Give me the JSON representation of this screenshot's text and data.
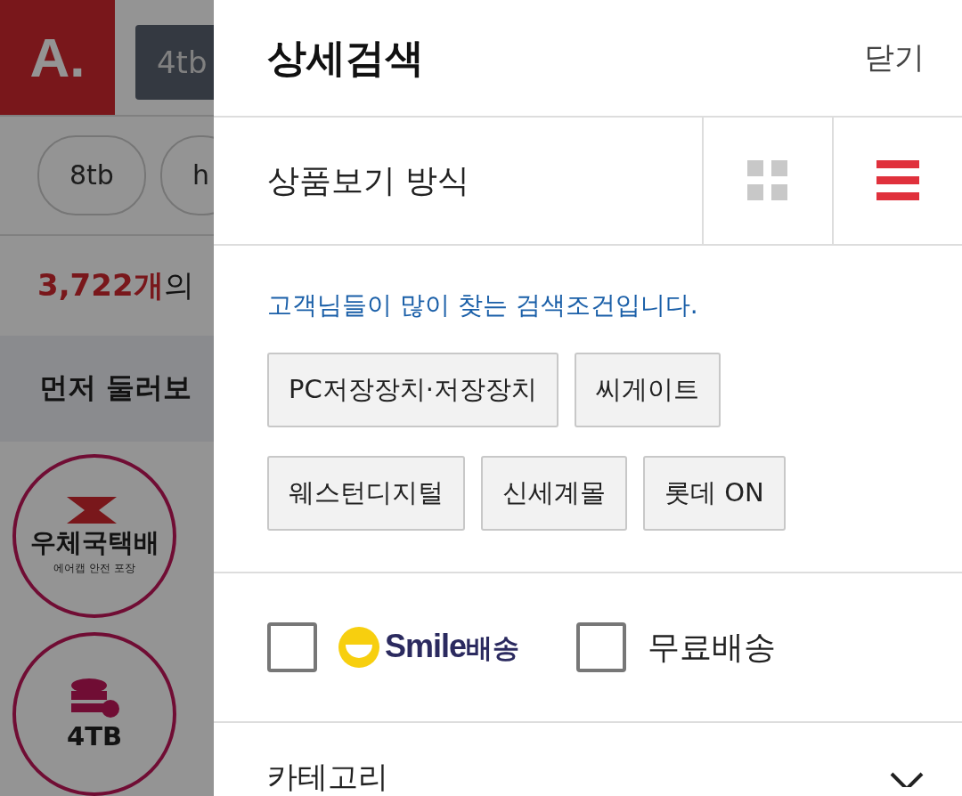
{
  "background_page": {
    "logo": "A.",
    "search_query": "4tb",
    "suggestion_chips": [
      {
        "label": "8tb"
      },
      {
        "label": "h"
      }
    ],
    "result_count": "3,722개",
    "result_suffix": "의",
    "section_title": "먼저 둘러보",
    "promo_badges": [
      {
        "title": "우체국택배",
        "subtitle": "에어캡 안전 포장"
      },
      {
        "title": "4TB"
      }
    ]
  },
  "panel": {
    "title": "상세검색",
    "close": "닫기",
    "view_mode": {
      "label": "상품보기 방식",
      "options": [
        {
          "kind": "grid",
          "selected": false
        },
        {
          "kind": "list",
          "selected": true
        }
      ]
    },
    "hint": "고객님들이 많이 찾는 검색조건입니다.",
    "chips": [
      {
        "label": "PC저장장치·저장장치"
      },
      {
        "label": "씨게이트"
      },
      {
        "label": "웨스턴디지털"
      },
      {
        "label": "신세계몰"
      },
      {
        "label": "롯데 ON"
      }
    ],
    "delivery_filters": [
      {
        "kind": "smile",
        "brand": "Smile",
        "label": "배송",
        "checked": false
      },
      {
        "kind": "plain",
        "label": "무료배송",
        "checked": false
      }
    ],
    "category": {
      "label": "카테고리",
      "expanded": false
    }
  }
}
